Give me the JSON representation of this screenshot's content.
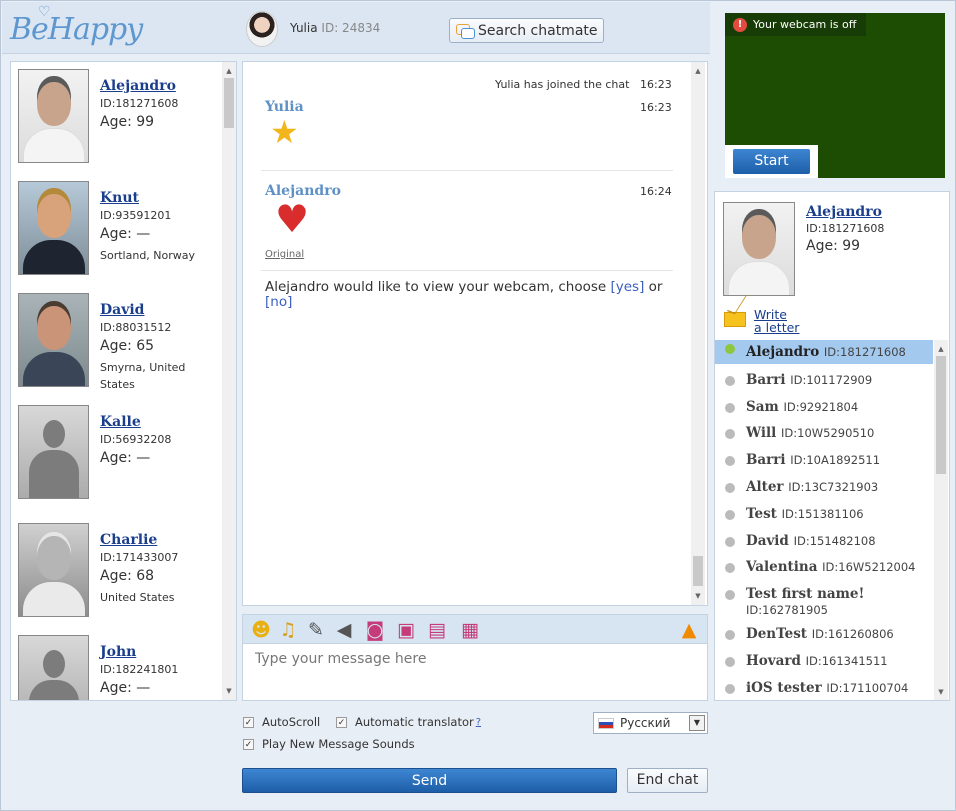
{
  "header": {
    "logo": "BeHappy",
    "self_name": "Yulia",
    "self_id": "ID: 24834",
    "search_label": "Search chatmate"
  },
  "contacts": [
    {
      "name": "Alejandro",
      "id": "ID:181271608",
      "age": "Age: 99",
      "location": ""
    },
    {
      "name": "Knut",
      "id": "ID:93591201",
      "age": "Age: —",
      "location": "Sortland, Norway"
    },
    {
      "name": "David",
      "id": "ID:88031512",
      "age": "Age: 65",
      "location": "Smyrna, United States"
    },
    {
      "name": "Kalle",
      "id": "ID:56932208",
      "age": "Age: —",
      "location": ""
    },
    {
      "name": "Charlie",
      "id": "ID:171433007",
      "age": "Age: 68",
      "location": "United States"
    },
    {
      "name": "John",
      "id": "ID:182241801",
      "age": "Age: —",
      "location": ""
    }
  ],
  "chat": {
    "system_line": "Yulia has joined the chat",
    "system_time": "16:23",
    "msg1_author": "Yulia",
    "msg1_time": "16:23",
    "msg2_author": "Alejandro",
    "msg2_time": "16:24",
    "original_label": "Original",
    "request_text": "Alejandro would like to view your webcam, choose",
    "yes": "[yes]",
    "or": "or",
    "no": "[no]"
  },
  "input": {
    "placeholder": "Type your message here"
  },
  "options": {
    "autoscroll": "AutoScroll",
    "translator": "Automatic translator",
    "translator_help": "?",
    "sounds": "Play New Message Sounds",
    "language": "Русский"
  },
  "buttons": {
    "send": "Send",
    "end_chat": "End chat"
  },
  "webcam": {
    "status": "Your webcam is off",
    "start": "Start"
  },
  "profile": {
    "name": "Alejandro",
    "id": "ID:181271608",
    "age": "Age: 99",
    "write_letter_1": "Write",
    "write_letter_2": "a letter"
  },
  "online": [
    {
      "name": "Alejandro",
      "id": "ID:181271608",
      "active": true
    },
    {
      "name": "Barri",
      "id": "ID:101172909"
    },
    {
      "name": "Sam",
      "id": "ID:92921804"
    },
    {
      "name": "Will",
      "id": "ID:10W5290510"
    },
    {
      "name": "Barri",
      "id": "ID:10A1892511"
    },
    {
      "name": "Alter",
      "id": "ID:13C7321903"
    },
    {
      "name": "Test",
      "id": "ID:151381106"
    },
    {
      "name": "David",
      "id": "ID:151482108"
    },
    {
      "name": "Valentina",
      "id": "ID:16W5212004"
    },
    {
      "name": "Test first name!",
      "id": "ID:162781905"
    },
    {
      "name": "DenTest",
      "id": "ID:161260806"
    },
    {
      "name": "Hovard",
      "id": "ID:161341511"
    },
    {
      "name": "iOS tester",
      "id": "ID:171100704"
    }
  ],
  "colors": {
    "accent": "#1e5ea8",
    "link": "#1a3e8c",
    "webcam_bg": "#1c4d02",
    "active_row": "#a4c9ef"
  }
}
